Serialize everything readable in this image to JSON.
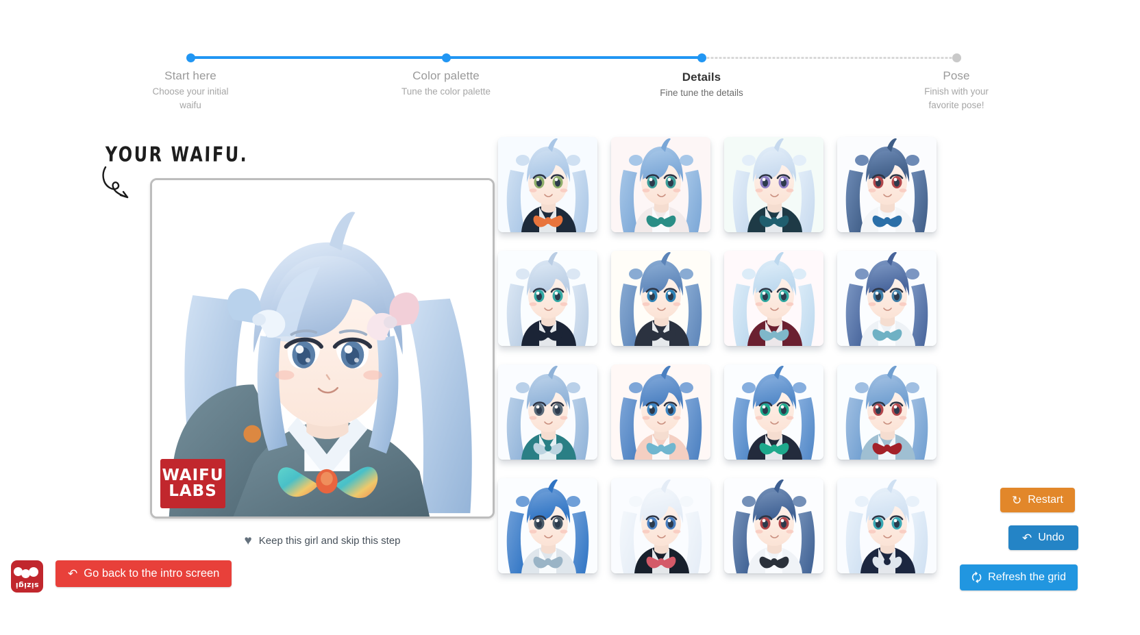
{
  "app": {
    "brand": "sizigi",
    "watermark_line1": "WAIFU",
    "watermark_line2": "LABS"
  },
  "stepper": {
    "steps": [
      {
        "title": "Start here",
        "desc": "Choose your initial waifu",
        "state": "done"
      },
      {
        "title": "Color palette",
        "desc": "Tune the color palette",
        "state": "done"
      },
      {
        "title": "Details",
        "desc": "Fine tune the details",
        "state": "current"
      },
      {
        "title": "Pose",
        "desc": "Finish with your favorite pose!",
        "state": "todo"
      }
    ],
    "active_color": "#2196f3",
    "inactive_color": "#c9c9c9"
  },
  "left": {
    "annotation": "YOUR WAIFU.",
    "annotation_icon": "curly-arrow-icon",
    "keep_label": "Keep this girl and skip this step",
    "keep_icon": "heart-icon",
    "intro_button": {
      "label": "Go back to the intro screen",
      "icon": "undo-arrow-icon",
      "color": "#e8403a"
    }
  },
  "actions": [
    {
      "id": "restart",
      "label": "Restart",
      "icon": "restart-icon",
      "color": "#e2872a"
    },
    {
      "id": "undo",
      "label": "Undo",
      "icon": "undo-icon",
      "color": "#2484c6"
    },
    {
      "id": "refresh",
      "label": "Refresh the grid",
      "icon": "refresh-icon",
      "color": "#2196e0"
    }
  ],
  "grid": {
    "rows": 4,
    "cols": 4,
    "cards": [
      {
        "i": 0,
        "hair": "#a9c6e6",
        "hair2": "#cfe0f2",
        "eye": "#8fae6b",
        "outfit": "#1d2a3a",
        "accent": "#e8743c",
        "tie": "#e8743c",
        "bg": "#f7fbff",
        "pose": "twin-tails-bow"
      },
      {
        "i": 1,
        "hair": "#7aa6d6",
        "hair2": "#a7c7e8",
        "eye": "#3c9e9a",
        "outfit": "#f2eaea",
        "accent": "#2a8e86",
        "tie": "#2a8e86",
        "bg": "#fdf6f6",
        "pose": "twin-tails-cat"
      },
      {
        "i": 2,
        "hair": "#c6d9ee",
        "hair2": "#e3eef9",
        "eye": "#8f7fc6",
        "outfit": "#1e3a46",
        "accent": "#1f5e6e",
        "tie": "#1f5e6e",
        "bg": "#f4fbf8",
        "pose": "twin-tails-buns"
      },
      {
        "i": 3,
        "hair": "#3f5d86",
        "hair2": "#6d8ab5",
        "eye": "#b2474b",
        "outfit": "#f4f6f8",
        "accent": "#2b6fa8",
        "tie": "#2b6fa8",
        "bg": "#fbfcfe",
        "pose": "dark-bob"
      },
      {
        "i": 4,
        "hair": "#b9cde4",
        "hair2": "#dbe7f4",
        "eye": "#32a9a4",
        "outfit": "#1b2436",
        "accent": "#1b2436",
        "tie": "#1b2436",
        "bg": "#fafdff",
        "pose": "ribbon-twin"
      },
      {
        "i": 5,
        "hair": "#5c84b8",
        "hair2": "#89abd3",
        "eye": "#2f84b8",
        "outfit": "#2b3240",
        "accent": "#2b3240",
        "tie": "#2b3240",
        "bg": "#fffdf8",
        "pose": "cat-ears"
      },
      {
        "i": 6,
        "hair": "#bcd8ee",
        "hair2": "#dcecf8",
        "eye": "#2fa8a0",
        "outfit": "#6b2030",
        "accent": "#7fb7c9",
        "tie": "#7fb7c9",
        "bg": "#fff9fb",
        "pose": "long-twin"
      },
      {
        "i": 7,
        "hair": "#46639a",
        "hair2": "#7b96c2",
        "eye": "#3f7fa8",
        "outfit": "#eef2f6",
        "accent": "#6fb1c4",
        "tie": "#6fb1c4",
        "bg": "#fbfdff",
        "pose": "dark-twin"
      },
      {
        "i": 8,
        "hair": "#8fb2d8",
        "hair2": "#b9d0e9",
        "eye": "#5a6a78",
        "outfit": "#2a7f85",
        "accent": "#2a7f85",
        "tie": "#bcd4e0",
        "bg": "#fafcff",
        "pose": "side-tails"
      },
      {
        "i": 9,
        "hair": "#4a7fc0",
        "hair2": "#7ea6d8",
        "eye": "#3e86c2",
        "outfit": "#f4cfc2",
        "accent": "#6fb6cf",
        "tie": "#6fb6cf",
        "bg": "#fff8f6",
        "pose": "open-mouth"
      },
      {
        "i": 10,
        "hair": "#4f86c6",
        "hair2": "#86aede",
        "eye": "#1ea98c",
        "outfit": "#232b3c",
        "accent": "#1ea98c",
        "tie": "#1ea98c",
        "bg": "#fbfdff",
        "pose": "smile-wave"
      },
      {
        "i": 11,
        "hair": "#6f9ed0",
        "hair2": "#a0bfe2",
        "eye": "#b2474b",
        "outfit": "#9fbfd2",
        "accent": "#a32129",
        "tie": "#a32129",
        "bg": "#fafdff",
        "pose": "red-ribbon"
      },
      {
        "i": 12,
        "hair": "#2f74c4",
        "hair2": "#6f9fd8",
        "eye": "#4a5a68",
        "outfit": "#dfe6ec",
        "accent": "#9ab4c6",
        "tie": "#9ab4c6",
        "bg": "#fbfdff",
        "pose": "short-tails"
      },
      {
        "i": 13,
        "hair": "#e4ecf6",
        "hair2": "#f4f8fc",
        "eye": "#4a7fc0",
        "outfit": "#18202c",
        "accent": "#d45a68",
        "tie": "#d45a68",
        "bg": "#fafcff",
        "pose": "white-long"
      },
      {
        "i": 14,
        "hair": "#3d5f92",
        "hair2": "#7490b8",
        "eye": "#b2474b",
        "outfit": "#f0f3f7",
        "accent": "#2b313a",
        "tie": "#2b313a",
        "bg": "#fcfdff",
        "pose": "dark-ribbon"
      },
      {
        "i": 15,
        "hair": "#cfe0f2",
        "hair2": "#e8f1fa",
        "eye": "#3aa8b4",
        "outfit": "#1c2740",
        "accent": "#1c2740",
        "tie": "#dfe6ee",
        "bg": "#fafcff",
        "pose": "pale-long"
      }
    ]
  },
  "main_portrait": {
    "hair": "#bcd0e8",
    "hair_light": "#dae6f4",
    "hair_shadow": "#9db6d4",
    "eye": "#5a7fa8",
    "outfit": "#5c7682",
    "bow_colors": [
      "#49c8c2",
      "#e8734a",
      "#f0d070",
      "#6fd6c8"
    ],
    "bg": "#ffffff"
  }
}
